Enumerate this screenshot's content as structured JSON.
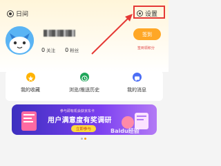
{
  "header": {
    "left_label": "日间",
    "right_label": "设置",
    "left_icon": "day-mode-icon",
    "right_icon": "gear-icon"
  },
  "profile": {
    "following_count": "0",
    "following_label": "关注",
    "followers_count": "0",
    "followers_label": "粉丝",
    "sign_button": "签到",
    "sign_subtitle": "签到领积分"
  },
  "quick_actions": [
    {
      "label": "我的收藏",
      "icon": "star-icon",
      "color": "#ffb300"
    },
    {
      "label": "浏览/推送历史",
      "icon": "clock-icon",
      "color": "#1fa65a"
    },
    {
      "label": "我的消息",
      "icon": "message-icon",
      "color": "#4c6ef5"
    }
  ],
  "banner": {
    "top_text": "参与即有机会获京东卡",
    "title": "用户满意度有奖调研",
    "button": "立即参与"
  },
  "watermark": "Baidu经验",
  "colors": {
    "accent": "#ffa726",
    "annotation": "#e53935",
    "banner_start": "#3d2fbf",
    "banner_end": "#b37af5"
  }
}
